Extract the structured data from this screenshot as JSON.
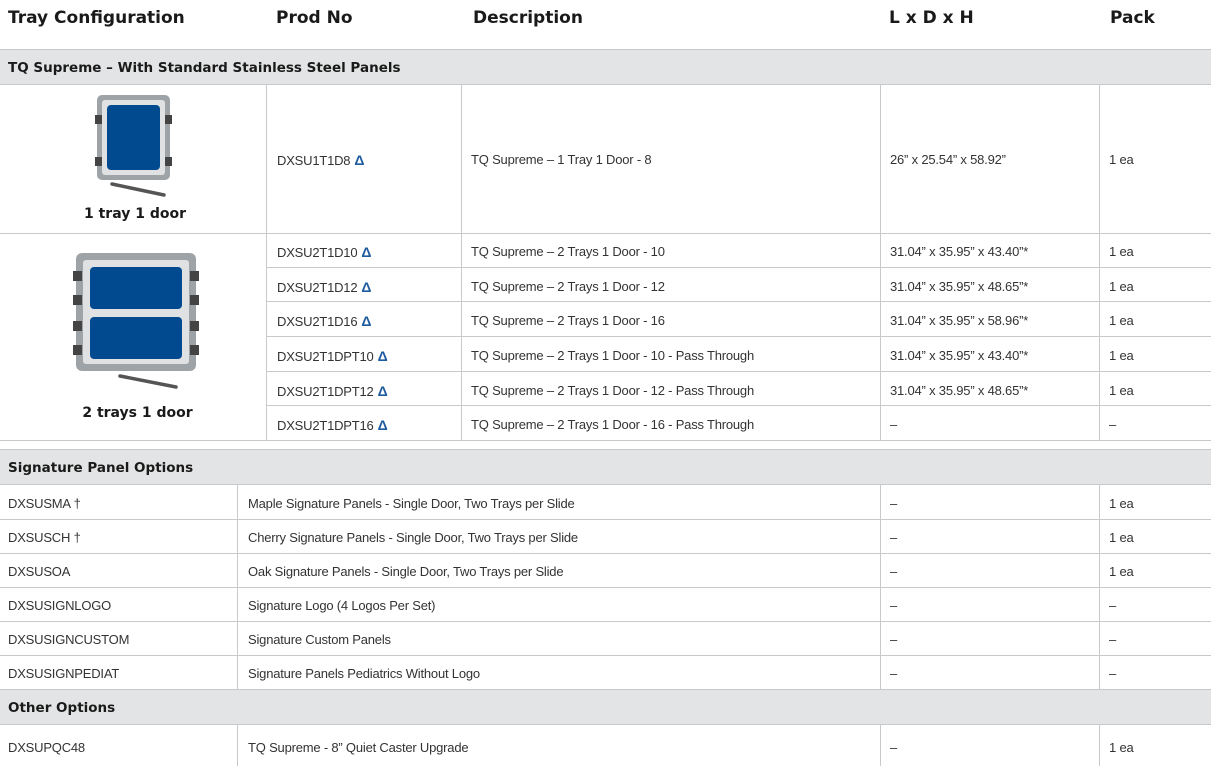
{
  "header": {
    "col_config": "Tray Configuration",
    "col_prod": "Prod No",
    "col_desc": "Description",
    "col_dims": "L x D x H",
    "col_pack": "Pack"
  },
  "sections": {
    "supreme": "TQ Supreme – With Standard Stainless Steel Panels",
    "signature": "Signature Panel Options",
    "other": "Other Options"
  },
  "config1": {
    "caption": "1 tray 1 door"
  },
  "config2": {
    "caption": "2 trays 1 door"
  },
  "delta_symbol": "Δ",
  "supreme_rows": [
    {
      "prod": "DXSU1T1D8",
      "desc": "TQ Supreme – 1 Tray 1 Door - 8",
      "dims": "26” x 25.54” x 58.92”",
      "pack": "1 ea"
    },
    {
      "prod": "DXSU2T1D10",
      "desc": "TQ Supreme – 2 Trays 1 Door - 10",
      "dims": "31.04” x 35.95” x 43.40”*",
      "pack": "1 ea"
    },
    {
      "prod": "DXSU2T1D12",
      "desc": "TQ Supreme – 2 Trays 1 Door - 12",
      "dims": "31.04” x 35.95” x 48.65”*",
      "pack": "1 ea"
    },
    {
      "prod": "DXSU2T1D16",
      "desc": "TQ Supreme – 2 Trays 1 Door - 16",
      "dims": "31.04” x 35.95” x 58.96”*",
      "pack": "1 ea"
    },
    {
      "prod": "DXSU2T1DPT10",
      "desc": "TQ Supreme – 2 Trays 1 Door - 10 - Pass Through",
      "dims": "31.04” x 35.95” x 43.40”*",
      "pack": "1 ea"
    },
    {
      "prod": "DXSU2T1DPT12",
      "desc": "TQ Supreme – 2 Trays 1 Door - 12 - Pass Through",
      "dims": "31.04” x 35.95” x 48.65”*",
      "pack": "1 ea"
    },
    {
      "prod": "DXSU2T1DPT16",
      "desc": "TQ Supreme – 2 Trays 1 Door - 16 - Pass Through",
      "dims": "–",
      "pack": "–"
    }
  ],
  "signature_rows": [
    {
      "prod": "DXSUSMA †",
      "desc": "Maple Signature Panels - Single Door, Two Trays per Slide",
      "dims": "–",
      "pack": "1 ea"
    },
    {
      "prod": "DXSUSCH †",
      "desc": "Cherry Signature Panels - Single Door, Two Trays per Slide",
      "dims": "–",
      "pack": "1 ea"
    },
    {
      "prod": "DXSUSOA",
      "desc": "Oak Signature Panels - Single Door, Two Trays per Slide",
      "dims": "–",
      "pack": "1 ea"
    },
    {
      "prod": "DXSUSIGNLOGO",
      "desc": "Signature Logo (4 Logos Per Set)",
      "dims": "–",
      "pack": "–"
    },
    {
      "prod": "DXSUSIGNCUSTOM",
      "desc": "Signature Custom Panels",
      "dims": "–",
      "pack": "–"
    },
    {
      "prod": "DXSUSIGNPEDIAT",
      "desc": "Signature Panels Pediatrics Without Logo",
      "dims": "–",
      "pack": "–"
    }
  ],
  "other_rows": [
    {
      "prod": "DXSUPQC48",
      "desc": "TQ Supreme - 8” Quiet Caster Upgrade",
      "dims": "–",
      "pack": "1 ea"
    }
  ],
  "colors": {
    "tray_blue": "#014a8f",
    "frame_gray": "#9ea3a8",
    "section_bg": "#e3e4e5",
    "delta_blue": "#1e5a9e"
  }
}
